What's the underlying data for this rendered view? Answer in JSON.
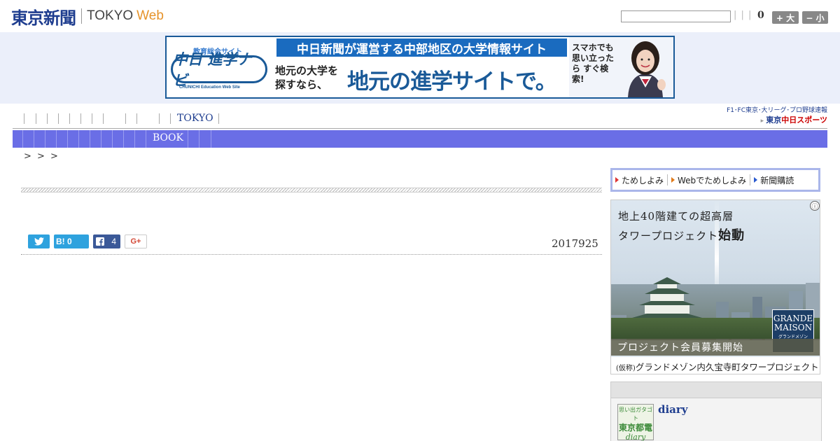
{
  "header": {
    "logo_jp": "東京新聞",
    "logo_tokyo": "TOKYO",
    "logo_web": "Web",
    "search_placeholder": "",
    "separators": "| | |",
    "count": "0",
    "font_up_label": "+ 大",
    "font_down_label": "− 小"
  },
  "banner": {
    "edu_label": "教育総合サイト",
    "logo_text": "中日 進学ナビ",
    "logo_sub": "CHUNICHI Education Web Site",
    "top_text": "中日新聞が運営する中部地区の大学情報サイト",
    "sub_text_1": "地元の大学を",
    "sub_text_2": "探すなら、",
    "main_text": "地元の進学サイトで。",
    "vertical_text": "スマホでも 思い立ったら すぐ検索!"
  },
  "nav": {
    "tokyo_label": "TOKYO",
    "sports_top": "F1･FC東京･大リーグ･プロ野球速報",
    "sports_bottom_prefix": "東京",
    "sports_bottom_main": "中日スポーツ"
  },
  "subnav": {
    "book_label": "BOOK"
  },
  "breadcrumb": ">   > >",
  "article": {
    "share_twitter": "",
    "share_hatena": "B! 0",
    "share_facebook_count": "4",
    "share_gplus": "G+",
    "date": "2017925"
  },
  "sidebar": {
    "tabs": [
      {
        "label": "ためしよみ",
        "color": "#d33"
      },
      {
        "label": "Webでためしよみ",
        "color": "#e07a1a"
      },
      {
        "label": "新聞購読",
        "color": "#2a5ad0"
      }
    ],
    "ad": {
      "info_icon": "ⓘ",
      "copy_line_1": "地上40階建ての超高層",
      "copy_line_2_a": "タワープロジェクト",
      "copy_line_2_b": "始動",
      "strip_text": "プロジェクト会員募集開始",
      "badge_line_1": "GRANDE",
      "badge_line_2": "MAISON",
      "badge_sub": "グランドメゾン",
      "bottom_prefix": "(仮称)",
      "bottom_text": "グランドメゾン内久宝寺町タワープロジェクト"
    },
    "diary": {
      "thumb_line_1": "思い出ガタゴト",
      "thumb_line_2": "東京都電",
      "thumb_line_3": "diary",
      "title": "diary"
    }
  },
  "colors": {
    "brand_navy": "#1e3d8f",
    "brand_orange": "#e6932a",
    "subnav_bg": "#6a6ee6",
    "banner_bg": "#ebeffa"
  }
}
